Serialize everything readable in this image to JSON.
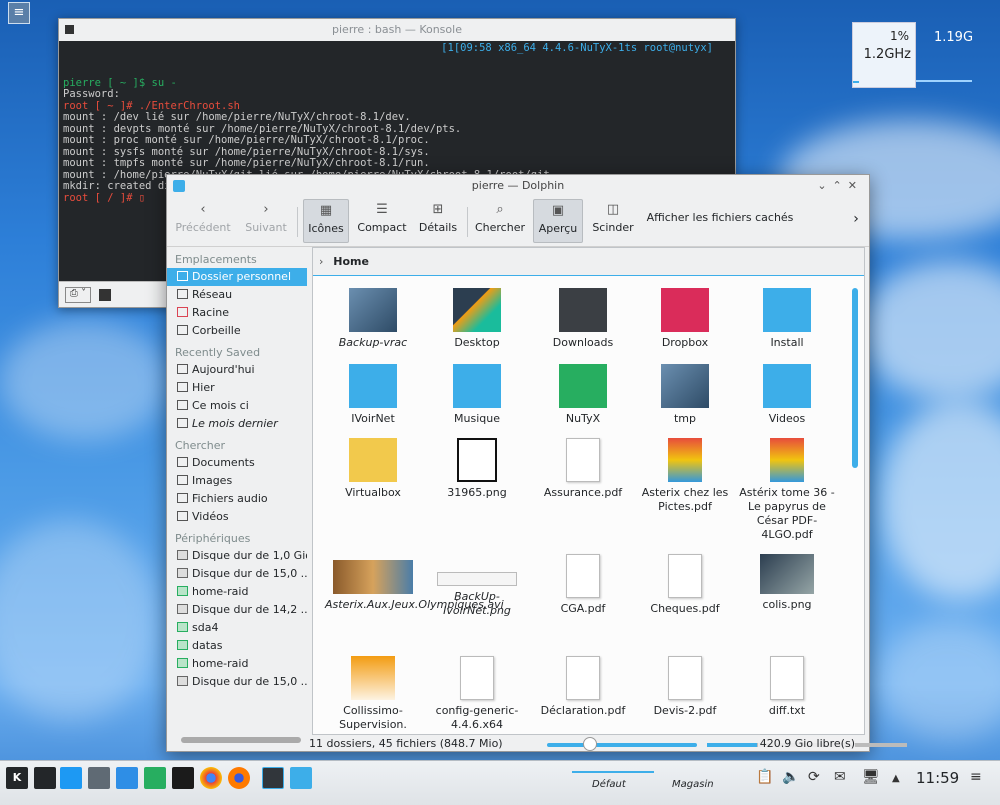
{
  "desktop": {
    "sysmon": {
      "cpu_percent": "1%",
      "cpu_freq": "1.2GHz",
      "memory": "1.19G"
    }
  },
  "konsole": {
    "title": "pierre : bash — Konsole",
    "right_status": "[1[09:58 x86_64 4.4.6-NuTyX-1ts root@nutyx]",
    "lines": [
      {
        "t": "pierre [ ~ ]$ su -",
        "c": "green"
      },
      {
        "t": "Password:",
        "c": ""
      },
      {
        "t": "root [ ~ ]# ./EnterChroot.sh",
        "c": "red"
      },
      {
        "t": "mount : /dev lié sur /home/pierre/NuTyX/chroot-8.1/dev.",
        "c": ""
      },
      {
        "t": "mount : devpts monté sur /home/pierre/NuTyX/chroot-8.1/dev/pts.",
        "c": ""
      },
      {
        "t": "mount : proc monté sur /home/pierre/NuTyX/chroot-8.1/proc.",
        "c": ""
      },
      {
        "t": "mount : sysfs monté sur /home/pierre/NuTyX/chroot-8.1/sys.",
        "c": ""
      },
      {
        "t": "mount : tmpfs monté sur /home/pierre/NuTyX/chroot-8.1/run.",
        "c": ""
      },
      {
        "t": "mount : /home/pierre/NuTyX/git lié sur /home/pierre/NuTyX/chroot-8.1/root/git.",
        "c": ""
      },
      {
        "t": "mkdir: created directory '/home/pierre/NuTyX/chroot-8.1//run/shm'",
        "c": ""
      },
      {
        "t": "root [ / ]# ",
        "c": "red"
      }
    ]
  },
  "dolphin": {
    "title": "pierre — Dolphin",
    "toolbar": {
      "back": "Précédent",
      "forward": "Suivant",
      "icons": "Icônes",
      "compact": "Compact",
      "details": "Détails",
      "search": "Chercher",
      "preview": "Aperçu",
      "split": "Scinder",
      "show_hidden": "Afficher les fichiers cachés"
    },
    "sidebar": {
      "places_head": "Emplacements",
      "places": [
        "Dossier personnel",
        "Réseau",
        "Racine",
        "Corbeille"
      ],
      "recent_head": "Recently Saved",
      "recent": [
        "Aujourd'hui",
        "Hier",
        "Ce mois ci",
        "Le mois dernier"
      ],
      "search_head": "Chercher",
      "search": [
        "Documents",
        "Images",
        "Fichiers audio",
        "Vidéos"
      ],
      "devices_head": "Périphériques",
      "devices": [
        "Disque dur de 1,0 Gio",
        "Disque dur de 15,0 ...",
        "home-raid",
        "Disque dur de 14,2 ...",
        "sda4",
        "datas",
        "home-raid",
        "Disque dur de 15,0 ..."
      ]
    },
    "breadcrumb": "Home",
    "files": [
      {
        "name": "Backup-vrac",
        "kind": "photo",
        "italic": true
      },
      {
        "name": "Desktop",
        "kind": "desktop",
        "italic": false
      },
      {
        "name": "Downloads",
        "kind": "downloads",
        "italic": false
      },
      {
        "name": "Dropbox",
        "kind": "dropbox",
        "italic": false
      },
      {
        "name": "Install",
        "kind": "folder",
        "italic": false
      },
      {
        "name": "IVoirNet",
        "kind": "folder",
        "italic": false
      },
      {
        "name": "Musique",
        "kind": "music",
        "italic": false
      },
      {
        "name": "NuTyX",
        "kind": "nutyx",
        "italic": false
      },
      {
        "name": "tmp",
        "kind": "photo",
        "italic": false
      },
      {
        "name": "Videos",
        "kind": "video",
        "italic": false
      },
      {
        "name": "Virtualbox",
        "kind": "yellow",
        "italic": false
      },
      {
        "name": "31965.png",
        "kind": "phone",
        "italic": false
      },
      {
        "name": "Assurance.pdf",
        "kind": "doc",
        "italic": false
      },
      {
        "name": "Asterix chez les Pictes.pdf",
        "kind": "comic",
        "italic": false
      },
      {
        "name": "Astérix tome 36 - Le papyrus de César PDF-4LGO.pdf",
        "kind": "comic",
        "italic": false
      },
      {
        "name": "Asterix.Aux.Jeux.Olympiques.avi",
        "kind": "movie",
        "italic": true
      },
      {
        "name": "BackUp-IvoirNet.png",
        "kind": "bar",
        "italic": true
      },
      {
        "name": "CGA.pdf",
        "kind": "doc",
        "italic": false
      },
      {
        "name": "Cheques.pdf",
        "kind": "doc",
        "italic": false
      },
      {
        "name": "colis.png",
        "kind": "screen",
        "italic": false
      },
      {
        "name": "Collissimo-Supervision.",
        "kind": "orange",
        "italic": false
      },
      {
        "name": "config-generic-4.4.6.x64",
        "kind": "doc",
        "italic": false
      },
      {
        "name": "Déclaration.pdf",
        "kind": "doc",
        "italic": false
      },
      {
        "name": "Devis-2.pdf",
        "kind": "doc",
        "italic": false
      },
      {
        "name": "diff.txt",
        "kind": "doc",
        "italic": false
      }
    ],
    "status": {
      "summary": "11 dossiers, 45 fichiers (848.7 Mio)",
      "free": "420.9 Gio libre(s)"
    }
  },
  "taskbar": {
    "activity_default": "Défaut",
    "activity_store": "Magasin",
    "clock": "11:59"
  }
}
